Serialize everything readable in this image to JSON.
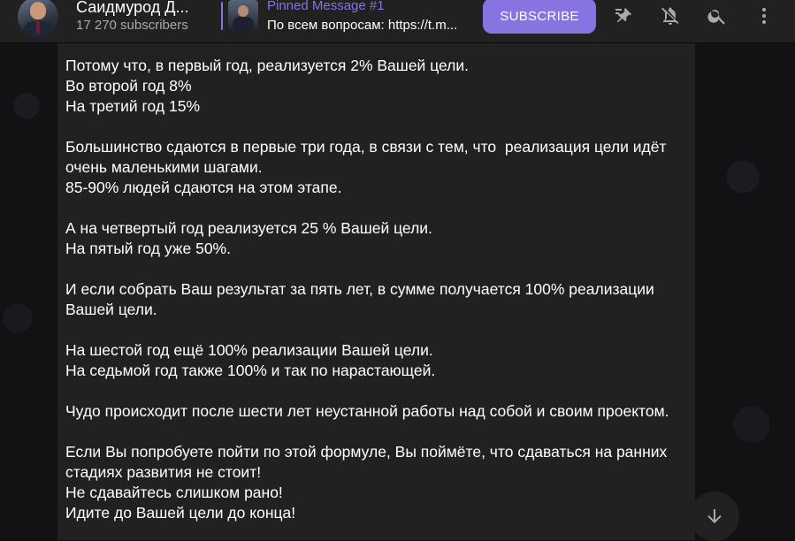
{
  "header": {
    "channel_title": "Саидмурод Д...",
    "subscribers": "17 270 subscribers",
    "pinned": {
      "title": "Pinned Message #1",
      "text": "По всем вопросам: https://t.m..."
    },
    "subscribe_label": "SUBSCRIBE",
    "icons": [
      "pinned-list-icon",
      "notifications-off-icon",
      "search-icon",
      "more-vertical-icon"
    ]
  },
  "message": {
    "lines": [
      "Потому что, в первый год, реализуется 2% Вашей цели.",
      "Во второй год 8%",
      "На третий год 15%",
      "",
      "Большинство сдаются в первые три года, в связи с тем, что  реализация цели идёт очень маленькими шагами.",
      "85-90% людей сдаются на этом этапе.",
      "",
      "А на четвертый год реализуется 25 % Вашей цели.",
      "На пятый год уже 50%.",
      "",
      "И если собрать Ваш результат за пять лет, в сумме получается 100% реализации Вашей цели.",
      "",
      "На шестой год ещё 100% реализации Вашей цели.",
      "На седьмой год также 100% и так по нарастающей.",
      "",
      "Чудо происходит после шести лет неустанной работы над собой и своим проектом.",
      "",
      "Если Вы попробуете пойти по этой формуле, Вы поймёте, что сдаваться на ранних стадиях развития не стоит!",
      "Не сдавайтесь слишком рано!",
      "Идите до Вашей цели до конца!"
    ]
  },
  "scroll_button_icon": "arrow-down-icon",
  "colors": {
    "accent": "#8774e1",
    "header_bg": "#212121",
    "bubble_bg": "#212121",
    "icon": "#aaaaaa"
  }
}
